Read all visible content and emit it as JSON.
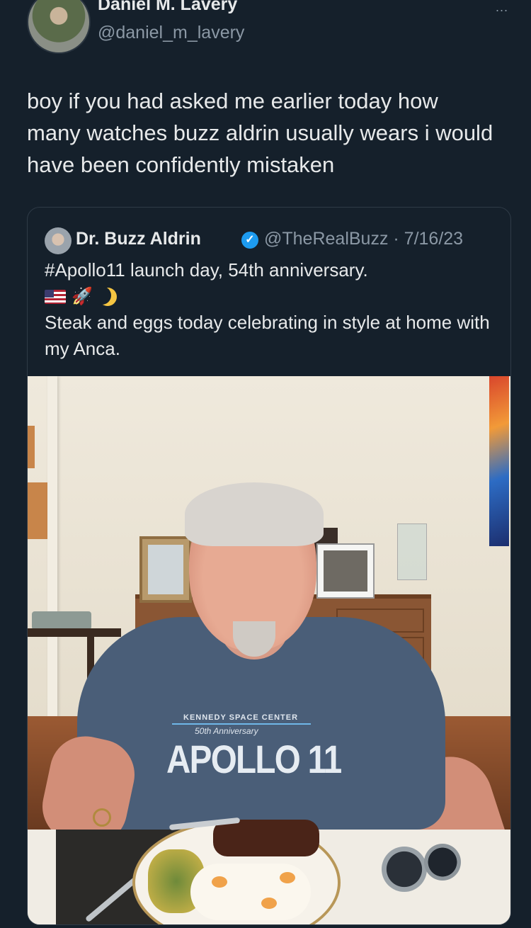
{
  "tweet": {
    "display_name": "Daniel M. Lavery",
    "handle": "@daniel_m_lavery",
    "more_label": "...",
    "text": "boy if you had asked me earlier today how many watches buzz aldrin usually wears i would have been confidently mistaken"
  },
  "quoted_tweet": {
    "display_name": "Dr. Buzz Aldrin",
    "verified_mark": "✓",
    "handle_date": "@TheRealBuzz · 7/16/23",
    "line1": "#Apollo11 launch day, 54th anniversary.",
    "emojis": [
      "us-flag-icon",
      "rocket-icon",
      "crescent-moon-icon"
    ],
    "rocket_glyph": "🚀",
    "line2": "Steak and eggs today celebrating in style at home with my Anca."
  },
  "photo": {
    "shirt_line1": "KENNEDY SPACE CENTER",
    "shirt_line2": "50th Anniversary",
    "shirt_line3": "APOLLO 11"
  },
  "colors": {
    "background": "#15202b",
    "text": "#e7e9ea",
    "muted": "#8b98a5",
    "verified": "#1d9bf0"
  }
}
